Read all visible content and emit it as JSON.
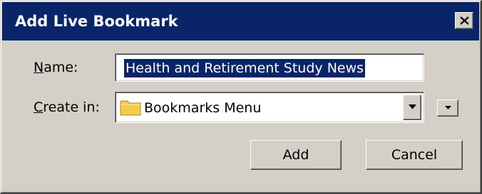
{
  "window": {
    "title": "Add Live Bookmark",
    "close_icon": "close-icon"
  },
  "form": {
    "name_label_accel": "N",
    "name_label_rest": "ame:",
    "name_value": "Health and Retirement Study News",
    "create_label_accel": "C",
    "create_label_rest": "reate in:",
    "create_value": "Bookmarks Menu",
    "folder_icon": "folder-icon",
    "dropdown_icon": "chevron-down-icon",
    "expand_icon": "expand-icon"
  },
  "buttons": {
    "add_label": "Add",
    "cancel_label": "Cancel"
  },
  "colors": {
    "titlebar": "#0a246a",
    "dialog_face": "#d4d0c8",
    "selection": "#0a246a",
    "folder": "#f4cc4c"
  }
}
